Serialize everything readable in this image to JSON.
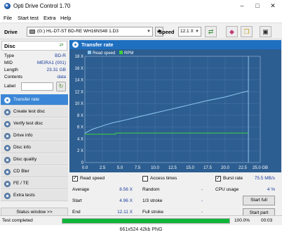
{
  "window": {
    "title": "Opti Drive Control 1.70",
    "controls": {
      "minimize": "–",
      "maximize": "□",
      "close": "✕"
    }
  },
  "menu": [
    "File",
    "Start test",
    "Extra",
    "Help"
  ],
  "drivebar": {
    "drive_label": "Drive",
    "drive_value": "(G:)  HL-DT-ST BD-RE  WH16NS48 1.D3",
    "speed_label": "Speed",
    "speed_value": "12.1 X"
  },
  "disc": {
    "header": "Disc",
    "rows": [
      {
        "key": "Type",
        "value": "BD-R"
      },
      {
        "key": "MID",
        "value": "MEIRA1 (001)"
      },
      {
        "key": "Length",
        "value": "23.31 GB"
      },
      {
        "key": "Contents",
        "value": "data"
      },
      {
        "key": "Label",
        "value": ""
      }
    ]
  },
  "nav": [
    {
      "label": "Transfer rate",
      "active": true
    },
    {
      "label": "Create test disc",
      "active": false
    },
    {
      "label": "Verify test disc",
      "active": false
    },
    {
      "label": "Drive info",
      "active": false
    },
    {
      "label": "Disc info",
      "active": false
    },
    {
      "label": "Disc quality",
      "active": false
    },
    {
      "label": "CD Bler",
      "active": false
    },
    {
      "label": "FE / TE",
      "active": false
    },
    {
      "label": "Extra tests",
      "active": false
    }
  ],
  "status_window_label": "Status window >>",
  "panel_title": "Transfer rate",
  "chart_data": {
    "type": "line",
    "legend": [
      "Read speed",
      "RPM"
    ],
    "x_ticks": [
      "0.0",
      "2.5",
      "5.0",
      "7.5",
      "10.0",
      "12.5",
      "15.0",
      "17.5",
      "20.0",
      "22.5",
      "25.0 GB"
    ],
    "y_ticks": [
      "0",
      "2 X",
      "4 X",
      "6 X",
      "8 X",
      "10 X",
      "12 X",
      "14 X",
      "16 X",
      "18 X"
    ],
    "xlim": [
      0,
      25
    ],
    "ylim": [
      0,
      18
    ],
    "series": [
      {
        "name": "Read speed",
        "x": [
          0.0,
          0.5,
          1.0,
          2.0,
          3.0,
          4.0,
          5.0,
          7.5,
          10.0,
          12.5,
          15.0,
          17.5,
          20.0,
          22.5,
          23.3
        ],
        "y": [
          4.96,
          5.3,
          5.6,
          6.0,
          6.4,
          6.75,
          7.0,
          7.7,
          8.4,
          9.1,
          9.8,
          10.5,
          11.1,
          11.9,
          12.11
        ]
      },
      {
        "name": "RPM",
        "x": [
          0.0,
          4.4,
          4.4,
          23.3
        ],
        "y": [
          4.8,
          4.8,
          5.0,
          5.0
        ]
      }
    ],
    "marker_x": 23.31,
    "colors": {
      "background": "#2d5e91",
      "read_speed": "#8ec8f0",
      "rpm": "#3fd13f",
      "grid": "#6b8fb8",
      "marker": "#8fc4ea"
    }
  },
  "stats": {
    "read_speed_label": "Read speed",
    "read_speed_checked": true,
    "access_times_label": "Access times",
    "access_times_checked": false,
    "burst_rate_label": "Burst rate",
    "burst_rate_checked": true,
    "burst_rate_value": "75.5 MB/s",
    "average_label": "Average",
    "average_value": "8.56 X",
    "start_label": "Start",
    "start_value": "4.96 X",
    "end_label": "End",
    "end_value": "12.11 X",
    "random_label": "Random",
    "random_value": "-",
    "one_third_label": "1/3 stroke",
    "one_third_value": "-",
    "full_stroke_label": "Full stroke",
    "full_stroke_value": "-",
    "cpu_label": "CPU usage",
    "cpu_value": "4 %",
    "start_full_label": "Start full",
    "start_part_label": "Start part"
  },
  "statusbar": {
    "text": "Test completed",
    "progress_percent": 100,
    "progress_text": "100.0%",
    "time": "00:03"
  },
  "caption": "661x524  42kb  PNG"
}
